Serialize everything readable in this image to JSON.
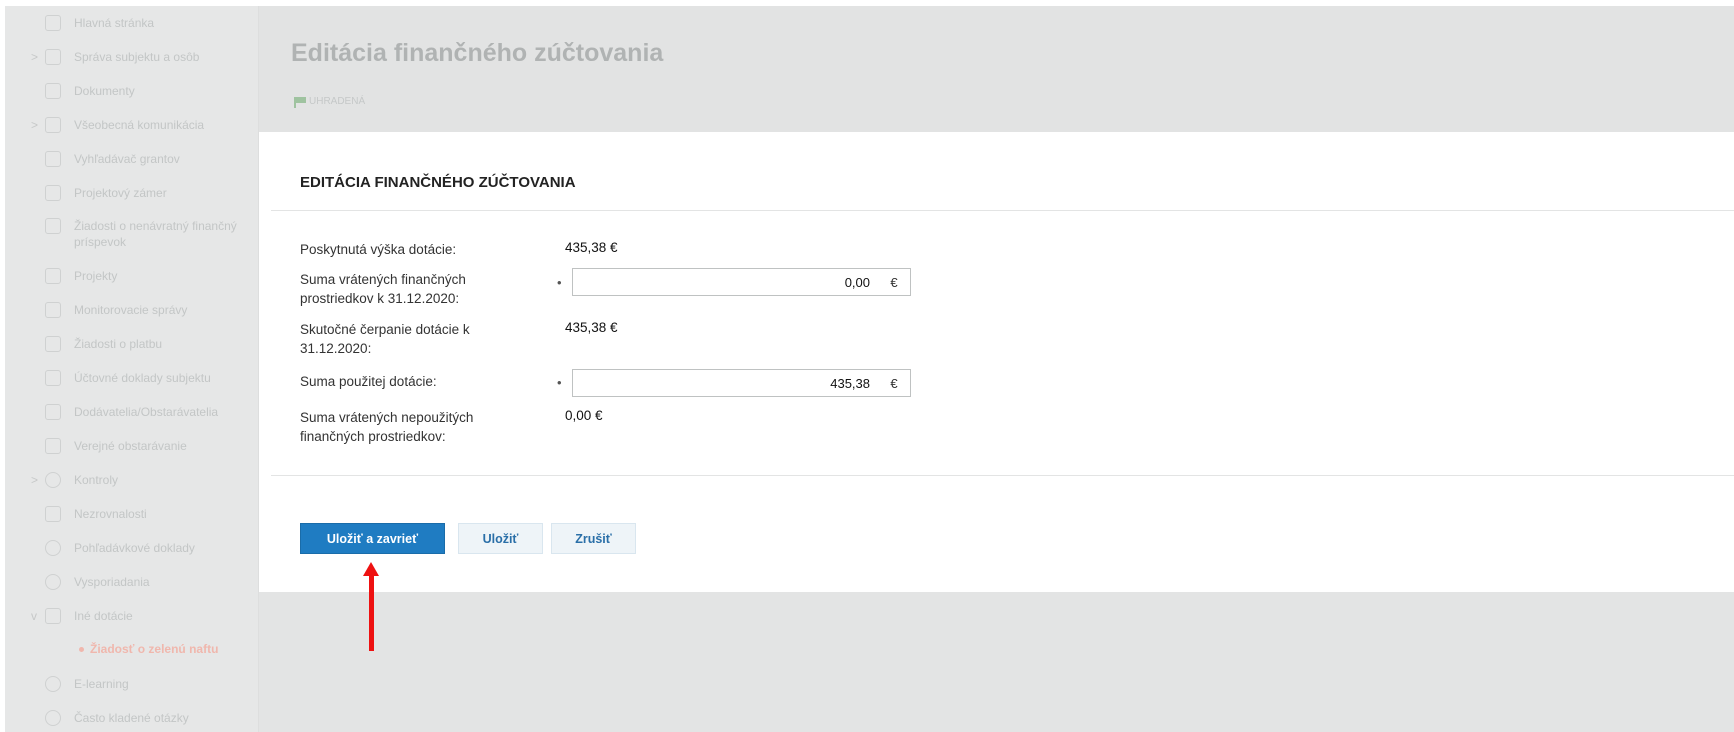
{
  "sidebar": {
    "items": [
      {
        "label": "Hlavná stránka",
        "arrow": ""
      },
      {
        "label": "Správa subjektu a osôb",
        "arrow": ">"
      },
      {
        "label": "Dokumenty",
        "arrow": ""
      },
      {
        "label": "Všeobecná komunikácia",
        "arrow": ">"
      },
      {
        "label": "Vyhľadávač grantov",
        "arrow": ""
      },
      {
        "label": "Projektový zámer",
        "arrow": ""
      },
      {
        "label": "Žiadosti o nenávratný finančný príspevok",
        "arrow": ""
      },
      {
        "label": "Projekty",
        "arrow": ""
      },
      {
        "label": "Monitorovacie správy",
        "arrow": ""
      },
      {
        "label": "Žiadosti o platbu",
        "arrow": ""
      },
      {
        "label": "Účtovné doklady subjektu",
        "arrow": ""
      },
      {
        "label": "Dodávatelia/Obstarávatelia",
        "arrow": ""
      },
      {
        "label": "Verejné obstarávanie",
        "arrow": ""
      },
      {
        "label": "Kontroly",
        "arrow": ">"
      },
      {
        "label": "Nezrovnalosti",
        "arrow": ""
      },
      {
        "label": "Pohľadávkové doklady",
        "arrow": ""
      },
      {
        "label": "Vysporiadania",
        "arrow": ""
      },
      {
        "label": "Iné dotácie",
        "arrow": "v"
      },
      {
        "label": "E-learning",
        "arrow": ""
      },
      {
        "label": "Často kladené otázky",
        "arrow": ""
      }
    ],
    "active_subitem": "Žiadosť o zelenú naftu"
  },
  "header": {
    "title": "Editácia finančného zúčtovania",
    "status": "UHRADENÁ"
  },
  "form": {
    "title": "EDITÁCIA FINANČNÉHO ZÚČTOVANIA",
    "rows": [
      {
        "label": "Poskytnutá výška dotácie:",
        "value": "435,38 €"
      },
      {
        "label": "Suma vrátených finančných prostriedkov k 31.12.2020:",
        "input_value": "0,00",
        "unit": "€"
      },
      {
        "label": "Skutočné čerpanie dotácie k 31.12.2020:",
        "value": "435,38 €"
      },
      {
        "label": "Suma použitej dotácie:",
        "input_value": "435,38",
        "unit": "€"
      },
      {
        "label": "Suma vrátených nepoužitých finančných prostriedkov:",
        "value": "0,00 €"
      }
    ],
    "required_marker": "•",
    "buttons": {
      "save_close": "Uložiť a zavrieť",
      "save": "Uložiť",
      "cancel": "Zrušiť"
    }
  },
  "colors": {
    "primary": "#1f7cc2",
    "annotation_arrow": "#ee1111",
    "status_flag": "#9fc3a0"
  }
}
